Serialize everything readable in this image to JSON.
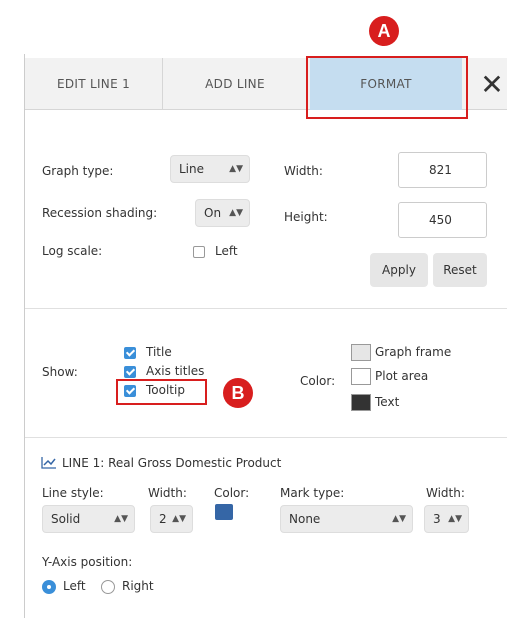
{
  "callouts": {
    "a": "A",
    "b": "B"
  },
  "tabs": [
    {
      "label": "EDIT LINE 1"
    },
    {
      "label": "ADD LINE"
    },
    {
      "label": "FORMAT"
    }
  ],
  "close_label": "✕",
  "format": {
    "graph_type_label": "Graph type:",
    "graph_type_value": "Line",
    "recession_label": "Recession shading:",
    "recession_value": "On",
    "log_scale_label": "Log scale:",
    "log_left_label": "Left",
    "width_label": "Width:",
    "width_value": "821",
    "height_label": "Height:",
    "height_value": "450",
    "apply_label": "Apply",
    "reset_label": "Reset"
  },
  "show": {
    "label": "Show:",
    "title_label": "Title",
    "axis_titles_label": "Axis titles",
    "tooltip_label": "Tooltip"
  },
  "color": {
    "label": "Color:",
    "graph_frame_label": "Graph frame",
    "plot_area_label": "Plot area",
    "text_label": "Text",
    "graph_frame_hex": "#e6e6e6",
    "plot_area_hex": "#ffffff",
    "text_hex": "#333333"
  },
  "line1": {
    "header": "LINE 1: Real Gross Domestic Product",
    "line_style_label": "Line style:",
    "line_style_value": "Solid",
    "width_label": "Width:",
    "width_value": "2",
    "color_label": "Color:",
    "color_hex": "#3566a6",
    "mark_type_label": "Mark type:",
    "mark_type_value": "None",
    "mark_width_label": "Width:",
    "mark_width_value": "3",
    "y_axis_label": "Y-Axis position:",
    "left_label": "Left",
    "right_label": "Right"
  }
}
